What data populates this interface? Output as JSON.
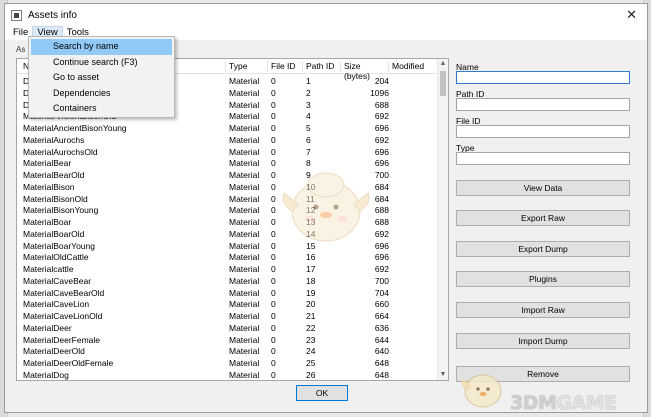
{
  "window": {
    "title": "Assets info",
    "close_glyph": "✕"
  },
  "menubar": {
    "file": "File",
    "view": "View",
    "tools": "Tools"
  },
  "view_menu": {
    "items": [
      {
        "label": "Search by name",
        "highlighted": true
      },
      {
        "label": "Continue search (F3)",
        "highlighted": false
      },
      {
        "label": "Go to asset",
        "highlighted": false
      },
      {
        "label": "Dependencies",
        "highlighted": false
      },
      {
        "label": "Containers",
        "highlighted": false
      }
    ]
  },
  "tab_stub": "As",
  "table": {
    "columns": [
      "N",
      "Type",
      "File ID",
      "Path ID",
      "Size (bytes)",
      "Modified"
    ],
    "rows": [
      {
        "name": "D",
        "type": "Material",
        "file_id": "0",
        "path_id": "1",
        "size": "204"
      },
      {
        "name": "D",
        "type": "Material",
        "file_id": "0",
        "path_id": "2",
        "size": "1096"
      },
      {
        "name": "D",
        "type": "Material",
        "file_id": "0",
        "path_id": "3",
        "size": "688"
      },
      {
        "name": "MaterialAncientBisonOld",
        "type": "Material",
        "file_id": "0",
        "path_id": "4",
        "size": "692"
      },
      {
        "name": "MaterialAncientBisonYoung",
        "type": "Material",
        "file_id": "0",
        "path_id": "5",
        "size": "696"
      },
      {
        "name": "MaterialAurochs",
        "type": "Material",
        "file_id": "0",
        "path_id": "6",
        "size": "692"
      },
      {
        "name": "MaterialAurochsOld",
        "type": "Material",
        "file_id": "0",
        "path_id": "7",
        "size": "696"
      },
      {
        "name": "MaterialBear",
        "type": "Material",
        "file_id": "0",
        "path_id": "8",
        "size": "696"
      },
      {
        "name": "MaterialBearOld",
        "type": "Material",
        "file_id": "0",
        "path_id": "9",
        "size": "700"
      },
      {
        "name": "MaterialBison",
        "type": "Material",
        "file_id": "0",
        "path_id": "10",
        "size": "684"
      },
      {
        "name": "MaterialBisonOld",
        "type": "Material",
        "file_id": "0",
        "path_id": "11",
        "size": "684"
      },
      {
        "name": "MaterialBisonYoung",
        "type": "Material",
        "file_id": "0",
        "path_id": "12",
        "size": "688"
      },
      {
        "name": "MaterialBoar",
        "type": "Material",
        "file_id": "0",
        "path_id": "13",
        "size": "688"
      },
      {
        "name": "MaterialBoarOld",
        "type": "Material",
        "file_id": "0",
        "path_id": "14",
        "size": "692"
      },
      {
        "name": "MaterialBoarYoung",
        "type": "Material",
        "file_id": "0",
        "path_id": "15",
        "size": "696"
      },
      {
        "name": "MaterialOldCattle",
        "type": "Material",
        "file_id": "0",
        "path_id": "16",
        "size": "696"
      },
      {
        "name": "Materialcattle",
        "type": "Material",
        "file_id": "0",
        "path_id": "17",
        "size": "692"
      },
      {
        "name": "MaterialCaveBear",
        "type": "Material",
        "file_id": "0",
        "path_id": "18",
        "size": "700"
      },
      {
        "name": "MaterialCaveBearOld",
        "type": "Material",
        "file_id": "0",
        "path_id": "19",
        "size": "704"
      },
      {
        "name": "MaterialCaveLion",
        "type": "Material",
        "file_id": "0",
        "path_id": "20",
        "size": "660"
      },
      {
        "name": "MaterialCaveLionOld",
        "type": "Material",
        "file_id": "0",
        "path_id": "21",
        "size": "664"
      },
      {
        "name": "MaterialDeer",
        "type": "Material",
        "file_id": "0",
        "path_id": "22",
        "size": "636"
      },
      {
        "name": "MaterialDeerFemale",
        "type": "Material",
        "file_id": "0",
        "path_id": "23",
        "size": "644"
      },
      {
        "name": "MaterialDeerOld",
        "type": "Material",
        "file_id": "0",
        "path_id": "24",
        "size": "640"
      },
      {
        "name": "MaterialDeerOldFemale",
        "type": "Material",
        "file_id": "0",
        "path_id": "25",
        "size": "648"
      },
      {
        "name": "MaterialDog",
        "type": "Material",
        "file_id": "0",
        "path_id": "26",
        "size": "648"
      }
    ]
  },
  "side_panel": {
    "name_label": "Name",
    "path_id_label": "Path ID",
    "file_id_label": "File ID",
    "type_label": "Type",
    "buttons": {
      "view_data": "View Data",
      "export_raw": "Export Raw",
      "export_dump": "Export Dump",
      "plugins": "Plugins",
      "import_raw": "Import Raw",
      "import_dump": "Import Dump",
      "remove": "Remove"
    }
  },
  "footer": {
    "ok": "OK"
  },
  "watermark": {
    "text_a": "3DM",
    "text_b": "GAME"
  },
  "colors": {
    "menu_highlight": "#91c9f7",
    "focus_border": "#2f7bd6",
    "ok_border": "#0078d7"
  }
}
